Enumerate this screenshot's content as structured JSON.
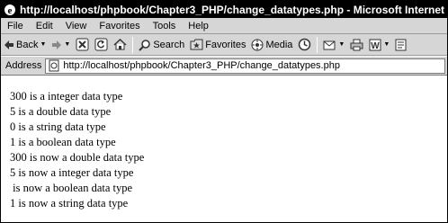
{
  "window": {
    "title": "http://localhost/phpbook/Chapter3_PHP/change_datatypes.php - Microsoft Internet Explorer"
  },
  "menu": [
    "File",
    "Edit",
    "View",
    "Favorites",
    "Tools",
    "Help"
  ],
  "toolbar": {
    "back_label": "Back",
    "search_label": "Search",
    "favorites_label": "Favorites",
    "media_label": "Media"
  },
  "address": {
    "label": "Address",
    "url": "http://localhost/phpbook/Chapter3_PHP/change_datatypes.php"
  },
  "output_lines": [
    "300 is a integer data type",
    "5 is a double data type",
    "0 is a string data type",
    "1 is a boolean data type",
    "300 is now a double data type",
    "5 is now a integer data type",
    " is now a boolean data type",
    "1 is now a string data type"
  ]
}
